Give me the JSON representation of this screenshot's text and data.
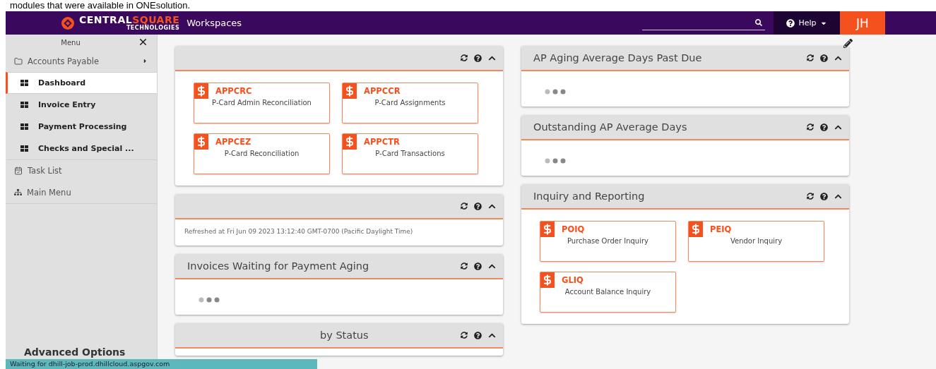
{
  "document_caption": "modules that were available in ONEsolution.",
  "header": {
    "logo": {
      "first": "CENTRAL",
      "second": "SQUARE",
      "sub": "TECHNOLOGIES"
    },
    "title": "Workspaces",
    "help": "Help",
    "user": "JH"
  },
  "sidebar": {
    "title": "Menu",
    "items": [
      {
        "kind": "folder",
        "label": "Accounts Payable",
        "selected": false
      },
      {
        "kind": "page",
        "label": "Dashboard",
        "selected": true
      },
      {
        "kind": "page",
        "label": "Invoice Entry",
        "selected": false
      },
      {
        "kind": "page",
        "label": "Payment Processing",
        "selected": false
      },
      {
        "kind": "page",
        "label": "Checks and Special ...",
        "selected": false
      },
      {
        "kind": "tasks",
        "label": "Task List",
        "selected": false
      },
      {
        "kind": "tree",
        "label": "Main Menu",
        "selected": false
      }
    ],
    "footer": "Advanced Options"
  },
  "columns": [
    [
      {
        "kind": "apps",
        "apps": [
          {
            "code": "APPCRC",
            "name": "P-Card Admin Reconciliation"
          },
          {
            "code": "APPCCR",
            "name": "P-Card Assignments"
          },
          {
            "code": "APPCEZ",
            "name": "P-Card Reconciliation"
          },
          {
            "code": "APPCTR",
            "name": "P-Card Transactions"
          }
        ]
      },
      {
        "kind": "text",
        "text": "Refreshed at Fri Jun 09 2023 13:12:40 GMT-0700 (Pacific Daylight Time)"
      },
      {
        "kind": "loading",
        "title": "Invoices Waiting for Payment Aging"
      },
      {
        "kind": "partial",
        "title": "by Status"
      }
    ],
    [
      {
        "kind": "loading",
        "title": "AP Aging Average Days Past Due"
      },
      {
        "kind": "loading",
        "title": "Outstanding AP Average Days"
      },
      {
        "kind": "apps",
        "title": "Inquiry and Reporting",
        "apps": [
          {
            "code": "POIQ",
            "name": "Purchase Order Inquiry"
          },
          {
            "code": "PEIQ",
            "name": "Vendor Inquiry"
          },
          {
            "code": "GLIQ",
            "name": "Account Balance Inquiry"
          }
        ]
      }
    ]
  ],
  "status_bar": "Waiting for dhill-job-prod.dhillcloud.aspgov.com"
}
